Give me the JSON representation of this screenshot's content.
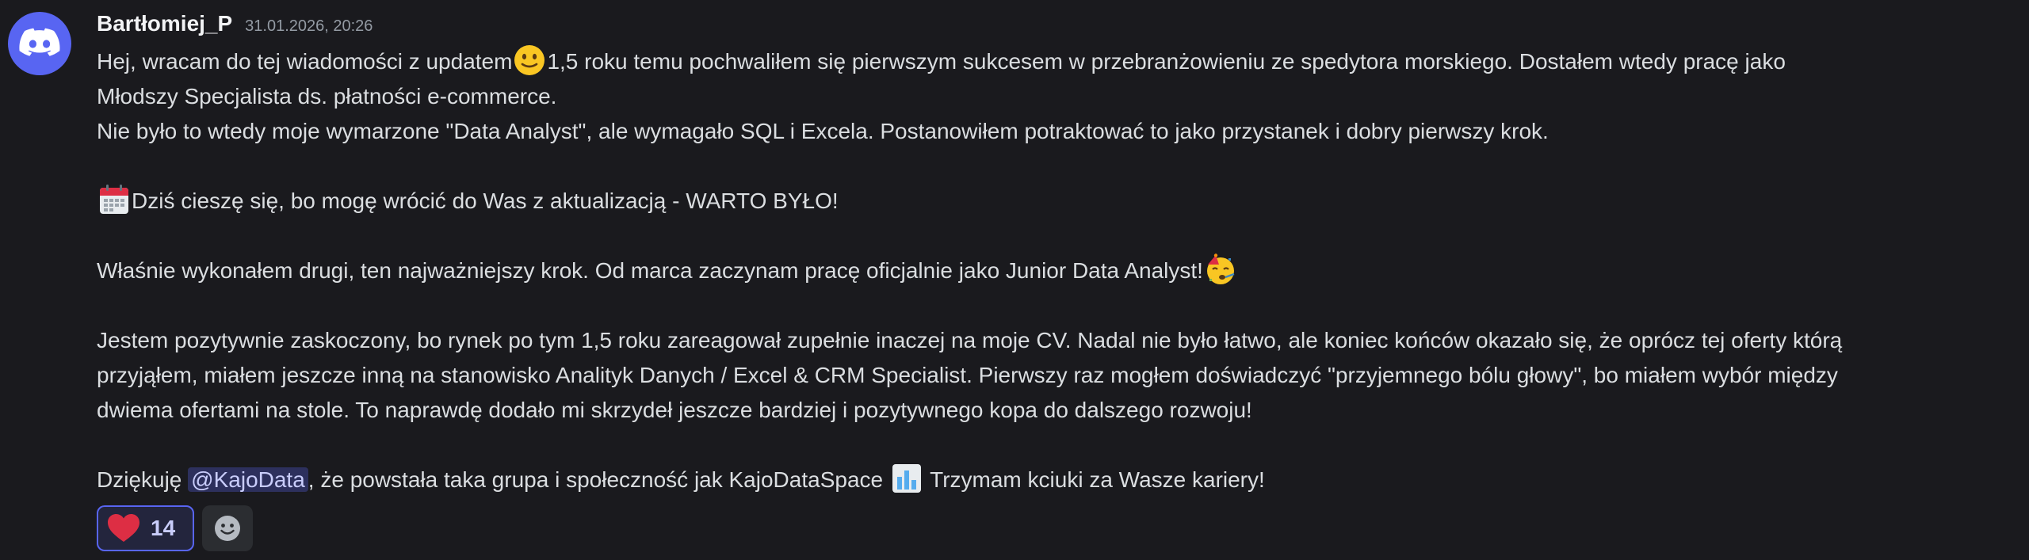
{
  "message": {
    "author": "Bartłomiej_P",
    "timestamp": "31.01.2026, 20:26",
    "avatar_icon": "discord-logo-icon",
    "lines": {
      "l1a": "Hej, wracam do tej wiadomości  z updatem",
      "l1b": "1,5 roku temu pochwaliłem się pierwszym sukcesem w przebranżowieniu ze spedytora morskiego. Dostałem wtedy pracę jako",
      "l2": "Młodszy Specjalista ds. płatności e-commerce.",
      "l3": "Nie było to wtedy moje wymarzone \"Data Analyst\", ale wymagało SQL i Excela. Postanowiłem potraktować to jako przystanek i dobry pierwszy krok.",
      "l4": "Dziś cieszę się, bo mogę wrócić do Was z aktualizacją - WARTO BYŁO!",
      "l5": "Właśnie wykonałem drugi, ten najważniejszy krok. Od marca zaczynam pracę oficjalnie jako Junior Data Analyst!",
      "l6": "Jestem pozytywnie zaskoczony, bo rynek po tym 1,5 roku zareagował zupełnie inaczej na moje CV. Nadal nie było łatwo, ale koniec końców okazało się, że oprócz tej oferty którą",
      "l7": "przyjąłem, miałem jeszcze inną na stanowisko Analityk Danych / Excel & CRM Specialist. Pierwszy raz mogłem doświadczyć \"przyjemnego bólu głowy\", bo miałem wybór między",
      "l8": "dwiema ofertami na stole. To naprawdę dodało mi skrzydeł jeszcze bardziej i pozytywnego kopa do dalszego rozwoju!",
      "l9a": "Dziękuję",
      "mention": "@KajoData",
      "l9b": ", że powstała taka grupa i społeczność jak KajoDataSpace",
      "l9c": " Trzymam kciuki za Wasze kariery!"
    },
    "emojis": [
      "slightly-smiling-face-icon",
      "calendar-icon",
      "partying-face-icon",
      "bar-chart-icon"
    ]
  },
  "reactions": [
    {
      "icon": "red-heart-icon",
      "count": "14"
    }
  ],
  "add_reaction_icon": "add-reaction-icon",
  "colors": {
    "background": "#1a1a1e",
    "accent": "#5865f2",
    "text": "#dbdee1",
    "username": "#f2f3f5",
    "muted": "#949ba4"
  }
}
